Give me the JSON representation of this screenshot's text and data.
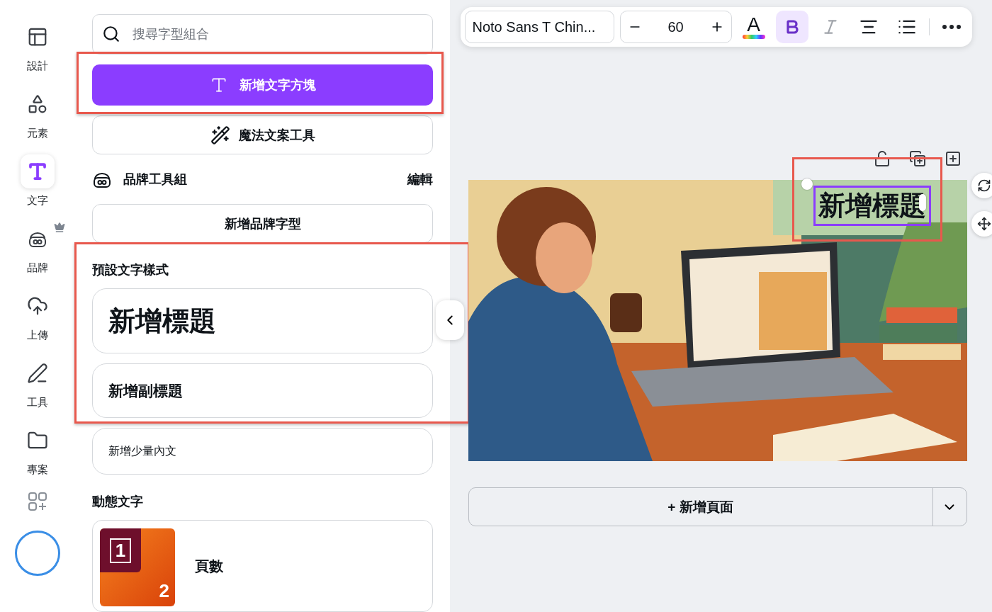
{
  "rail": {
    "items": [
      {
        "label": "設計",
        "selected": false,
        "premium": false
      },
      {
        "label": "元素",
        "selected": false,
        "premium": false
      },
      {
        "label": "文字",
        "selected": true,
        "premium": false
      },
      {
        "label": "品牌",
        "selected": false,
        "premium": true
      },
      {
        "label": "上傳",
        "selected": false,
        "premium": false
      },
      {
        "label": "工具",
        "selected": false,
        "premium": false
      },
      {
        "label": "專案",
        "selected": false,
        "premium": false
      }
    ]
  },
  "panel": {
    "search": {
      "placeholder": "搜尋字型組合"
    },
    "add_text_button": {
      "label": "新增文字方塊",
      "highlighted": true
    },
    "magic_button": {
      "label": "魔法文案工具"
    },
    "brand_kit": {
      "title": "品牌工具組",
      "edit": "編輯",
      "button": "新增品牌字型"
    },
    "default_styles": {
      "title": "預設文字樣式",
      "highlighted": true,
      "items": [
        {
          "kind": "heading",
          "label": "新增標題"
        },
        {
          "kind": "subheading",
          "label": "新增副標題"
        }
      ]
    },
    "body_button": {
      "label": "新增少量內文"
    },
    "dynamic_text": {
      "title": "動態文字",
      "items": [
        {
          "label": "頁數",
          "thumb_numbers": [
            "1",
            "2"
          ]
        }
      ]
    }
  },
  "toolbar": {
    "font": "Noto Sans T Chin...",
    "size": "60",
    "color_letter": "A",
    "bold": true,
    "italic": false
  },
  "canvas": {
    "text_box": {
      "text": "新增標題",
      "selected": true,
      "highlighted": true
    },
    "add_page": "+ 新增頁面"
  }
}
